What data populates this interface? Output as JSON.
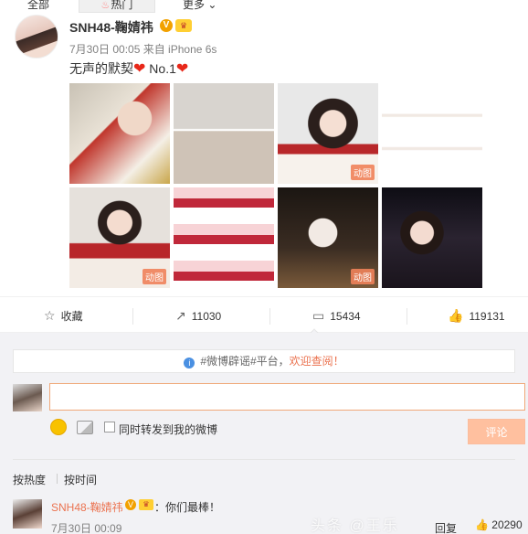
{
  "tabs": {
    "all": "全部",
    "hot": "热门",
    "more": "更多"
  },
  "post": {
    "username": "SNH48-鞠婧祎",
    "verified_mark": "V",
    "meta": "7月30日 00:05 来自 iPhone 6s",
    "text_before": "无声的默契",
    "text_after": " No.1",
    "heart": "❤",
    "photos": [
      {
        "gif": ""
      },
      {
        "gif": ""
      },
      {
        "gif": "动图"
      },
      {
        "gif": ""
      },
      {
        "gif": "动图"
      },
      {
        "gif": ""
      },
      {
        "gif": "动图"
      },
      {
        "gif": ""
      }
    ]
  },
  "actions": {
    "favorite": "收藏",
    "repost": "11030",
    "comment": "15434",
    "like": "119131"
  },
  "comments": {
    "notice_prefix": "#微博辟谣#平台，",
    "notice_highlight": "欢迎查阅！",
    "checkbox_label": "同时转发到我的微博",
    "submit": "评论",
    "sort_hot": "按热度",
    "sort_time": "按时间",
    "items": [
      {
        "user": "SNH48-鞠婧祎",
        "text": "：你们最棒！",
        "time": "7月30日 00:09",
        "reply": "回复",
        "likes": "20290"
      }
    ]
  },
  "watermark": "头条 @王乐"
}
